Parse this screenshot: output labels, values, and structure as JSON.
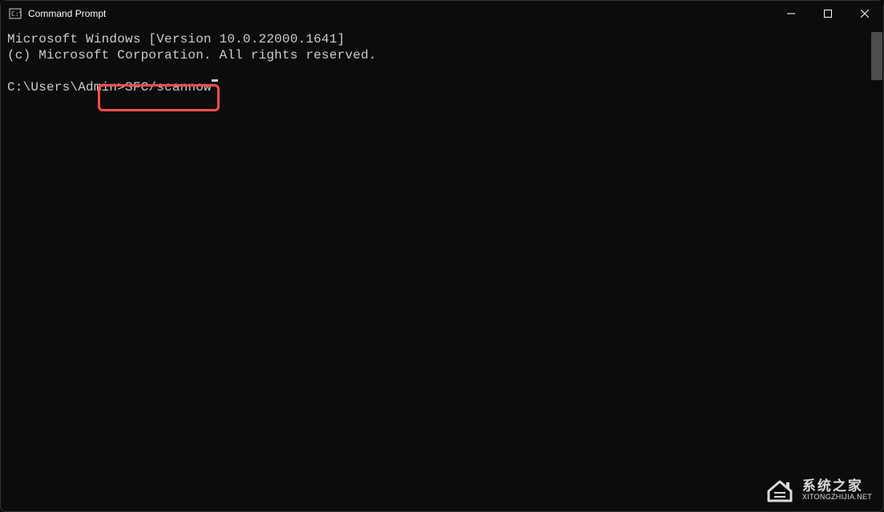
{
  "titlebar": {
    "title": "Command Prompt"
  },
  "terminal": {
    "version_line": "Microsoft Windows [Version 10.0.22000.1641]",
    "copyright_line": "(c) Microsoft Corporation. All rights reserved.",
    "prompt_path": "C:\\Users\\Admin>",
    "command": "SFC/scannow"
  },
  "watermark": {
    "cn": "系统之家",
    "en": "XITONGZHIJIA.NET"
  },
  "highlight": {
    "target": "command-input"
  }
}
